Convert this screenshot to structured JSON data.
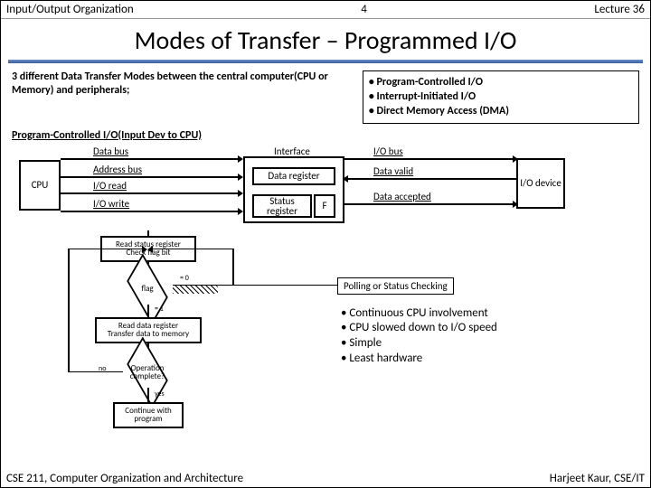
{
  "header": {
    "left": "Input/Output Organization",
    "center": "4",
    "right": "Lecture 36"
  },
  "title": "Modes of Transfer – Programmed I/O",
  "intro_left": "3 different Data Transfer Modes between the central computer(CPU or Memory)  and peripherals;",
  "intro_right": {
    "b1": "• Program-Controlled I/O",
    "b2": "• Interrupt-Initiated I/O",
    "b3": "• Direct Memory Access (DMA)"
  },
  "subheading": "Program-Controlled I/O(Input Dev to CPU)",
  "diagram": {
    "cpu": "CPU",
    "data_bus": "Data bus",
    "addr_bus": "Address bus",
    "io_read": "I/O read",
    "io_write": "I/O write",
    "interface": "Interface",
    "data_reg": "Data register",
    "status_reg": "Status register",
    "f": "F",
    "io_bus": "I/O bus",
    "data_valid": "Data valid",
    "data_acc": "Data accepted",
    "io_dev": "I/O device"
  },
  "flow": {
    "step1a": "Read status register",
    "step1b": "Check flag bit",
    "flag": "flag",
    "eq0": "= 0",
    "eq1": "= 1",
    "step2a": "Read data register",
    "step2b": "Transfer data to memory",
    "op": "Operation complete?",
    "no": "no",
    "yes": "yes",
    "cont": "Continue with program"
  },
  "poll_label": "Polling or Status Checking",
  "bullets": {
    "b1": "• Continuous CPU involvement",
    "b2": "• CPU slowed down to I/O speed",
    "b3": "• Simple",
    "b4": "• Least hardware"
  },
  "footer": {
    "left": "CSE 211, Computer Organization and Architecture",
    "right": "Harjeet Kaur, CSE/IT"
  }
}
